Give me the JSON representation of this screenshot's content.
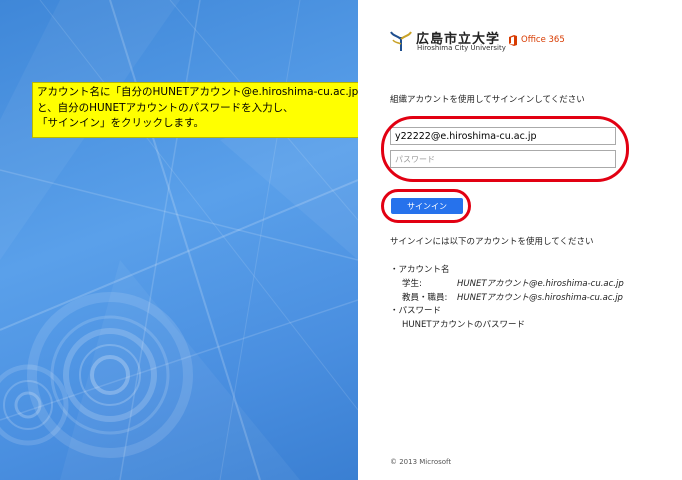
{
  "callout": {
    "line1": "アカウント名に「自分のHUNETアカウント@e.hiroshima-cu.ac.jp」",
    "line2": "と、自分のHUNETアカウントのパスワードを入力し、",
    "line3": "「サインイン」をクリックします。"
  },
  "brand": {
    "name_jp": "広島市立大学",
    "name_en": "Hiroshima City University",
    "office": "Office 365",
    "office_color": "#d83b01"
  },
  "form": {
    "prompt": "組織アカウントを使用してサインインしてください",
    "username_value": "y22222@e.hiroshima-cu.ac.jp",
    "password_placeholder": "パスワード",
    "signin_label": "サインイン"
  },
  "help": {
    "intro": "サインインには以下のアカウントを使用してください",
    "account_heading": "・アカウント名",
    "student_label": "学生:",
    "student_value": "HUNETアカウント@e.hiroshima-cu.ac.jp",
    "staff_label": "教員・職員:",
    "staff_value": "HUNETアカウント@s.hiroshima-cu.ac.jp",
    "password_heading": "・パスワード",
    "password_value": "HUNETアカウントのパスワード"
  },
  "footer": {
    "copyright": "© 2013 Microsoft"
  },
  "colors": {
    "accent_button": "#2672ec",
    "highlight_oval": "#e20012",
    "callout_bg": "#ffff00"
  }
}
